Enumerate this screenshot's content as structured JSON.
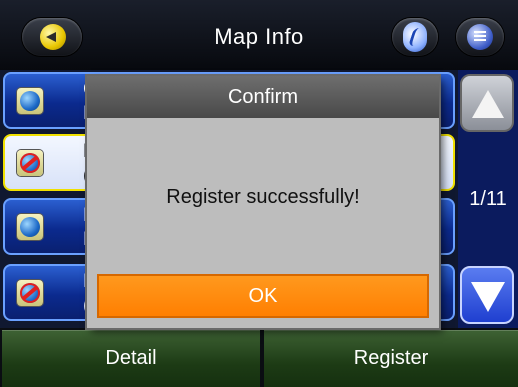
{
  "header": {
    "title": "Map Info",
    "back_icon": "back-arrow-icon",
    "nav_icon": "navigation-logo-icon",
    "menu_icon": "menu-icon"
  },
  "list": {
    "items": [
      {
        "line1": "C",
        "line2": "N",
        "icon": "globe-icon",
        "blocked": false
      },
      {
        "line1": "E",
        "line2": "(",
        "icon": "globe-blocked-icon",
        "blocked": true,
        "selected": true
      },
      {
        "line1": "H",
        "line2": "N",
        "icon": "globe-icon",
        "blocked": false
      },
      {
        "line1": "F",
        "line2": "(",
        "icon": "globe-blocked-icon",
        "blocked": true
      }
    ]
  },
  "scroll": {
    "page_indicator": "1/11",
    "up_icon": "scroll-up-icon",
    "down_icon": "scroll-down-icon"
  },
  "bottom": {
    "detail_label": "Detail",
    "register_label": "Register"
  },
  "dialog": {
    "title": "Confirm",
    "message": "Register successfully!",
    "ok_label": "OK"
  },
  "colors": {
    "ok_accent": "#ff8400",
    "selected_border": "#f0e000",
    "list_blue": "#0b2a8e"
  }
}
